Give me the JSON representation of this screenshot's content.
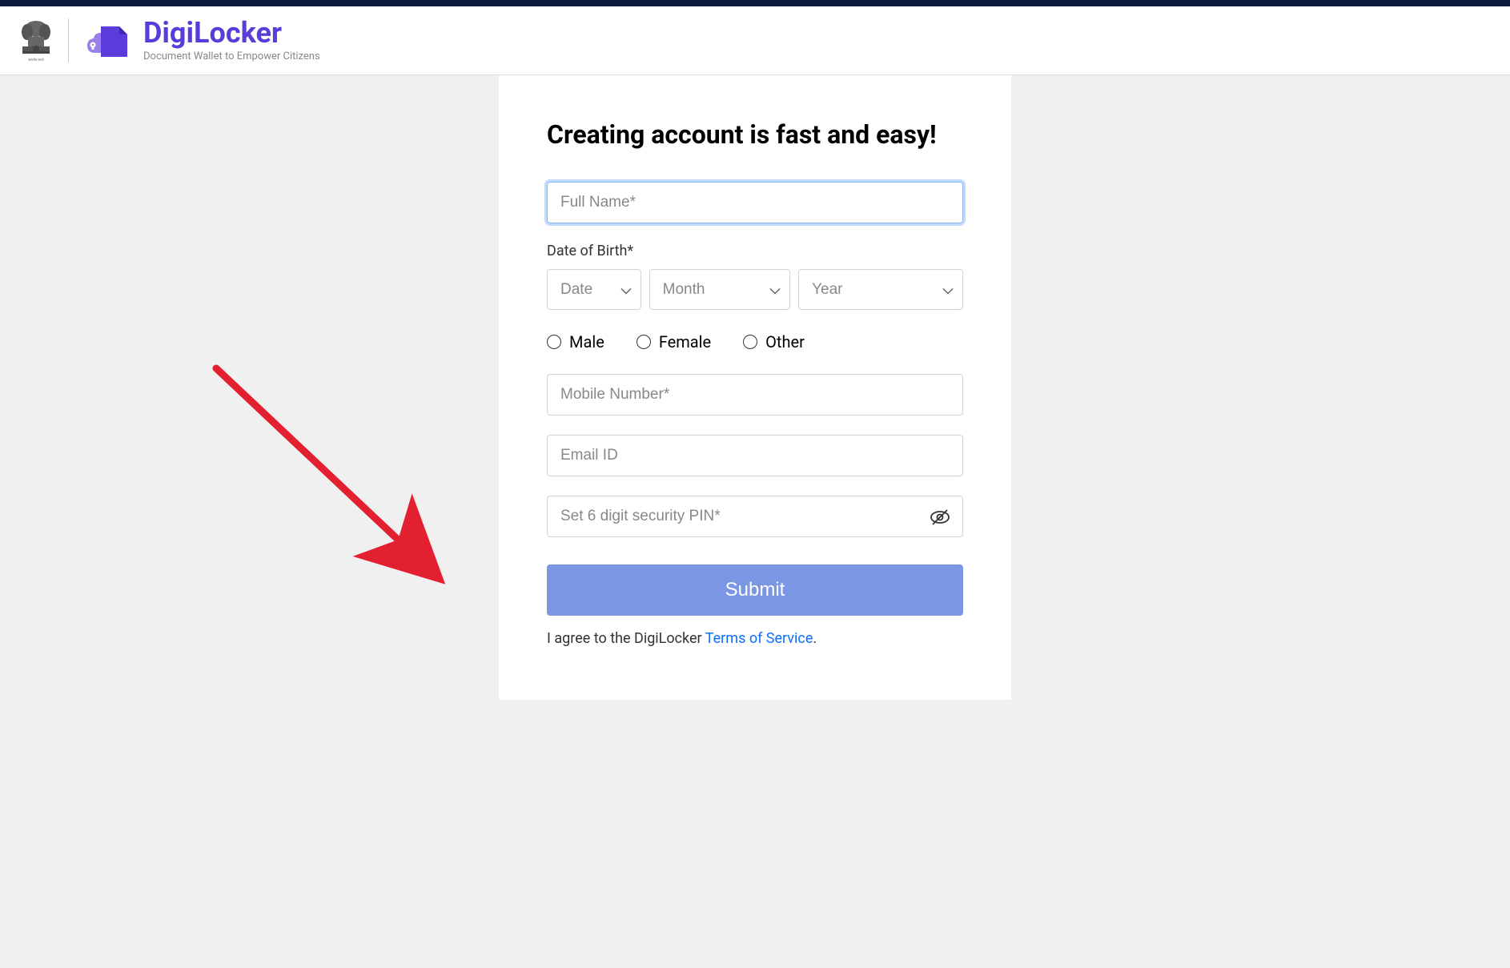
{
  "brand": {
    "name": "DigiLocker",
    "tagline": "Document Wallet to Empower Citizens"
  },
  "form": {
    "title": "Creating account is fast and easy!",
    "fullname_placeholder": "Full Name*",
    "dob_label": "Date of Birth*",
    "date_placeholder": "Date",
    "month_placeholder": "Month",
    "year_placeholder": "Year",
    "gender_male": "Male",
    "gender_female": "Female",
    "gender_other": "Other",
    "mobile_placeholder": "Mobile Number*",
    "email_placeholder": "Email ID",
    "pin_placeholder": "Set 6 digit security PIN*",
    "submit_label": "Submit",
    "agree_prefix": "I agree to the DigiLocker ",
    "terms_link": "Terms of Service",
    "agree_suffix": "."
  }
}
